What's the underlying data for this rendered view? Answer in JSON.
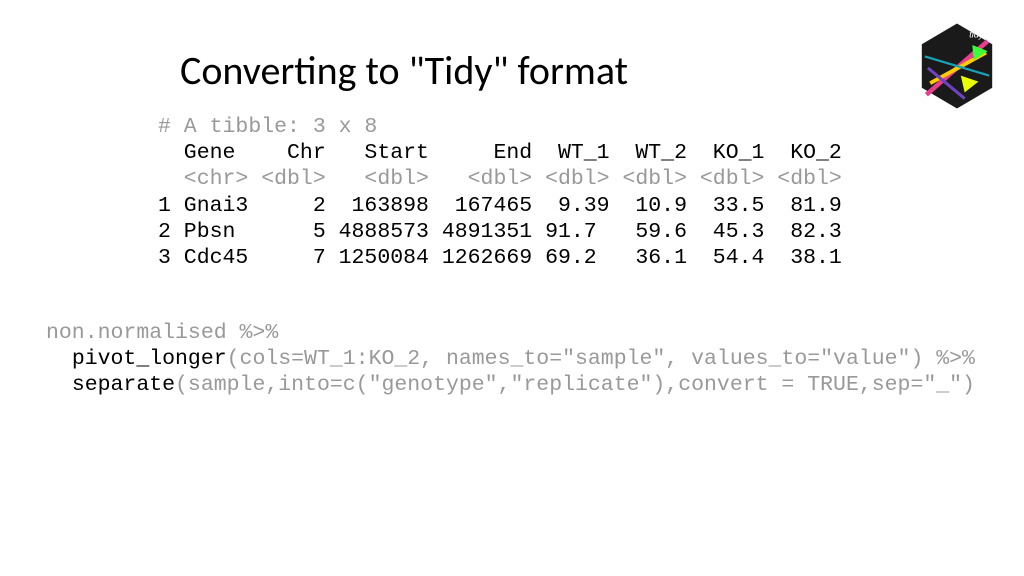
{
  "title": "Converting to \"Tidy\" format",
  "logo": {
    "name": "tidyr-hex-logo"
  },
  "tibble": {
    "header_comment": "# A tibble: 3 x 8",
    "col_header": "  Gene    Chr   Start     End  WT_1  WT_2  KO_1  KO_2",
    "type_row": "  <chr> <dbl>   <dbl>   <dbl> <dbl> <dbl> <dbl> <dbl>",
    "rows": [
      "1 Gnai3     2  163898  167465  9.39  10.9  33.5  81.9",
      "2 Pbsn      5 4888573 4891351 91.7   59.6  45.3  82.3",
      "3 Cdc45     7 1250084 1262669 69.2   36.1  54.4  38.1"
    ]
  },
  "code": {
    "line1_pre": "non.normalised %>%",
    "line2_indent": "  ",
    "line2_fn": "pivot_longer",
    "line2_args": "(cols=WT_1:KO_2, names_to=\"sample\", values_to=\"value\") %>%",
    "line3_indent": "  ",
    "line3_fn": "separate",
    "line3_args": "(sample,into=c(\"genotype\",\"replicate\"),convert = TRUE,sep=\"_\")"
  },
  "chart_data": {
    "type": "table",
    "title": "A tibble: 3 x 8",
    "columns": [
      "Gene",
      "Chr",
      "Start",
      "End",
      "WT_1",
      "WT_2",
      "KO_1",
      "KO_2"
    ],
    "column_types": [
      "<chr>",
      "<dbl>",
      "<dbl>",
      "<dbl>",
      "<dbl>",
      "<dbl>",
      "<dbl>",
      "<dbl>"
    ],
    "rows": [
      {
        "Gene": "Gnai3",
        "Chr": 2,
        "Start": 163898,
        "End": 167465,
        "WT_1": 9.39,
        "WT_2": 10.9,
        "KO_1": 33.5,
        "KO_2": 81.9
      },
      {
        "Gene": "Pbsn",
        "Chr": 5,
        "Start": 4888573,
        "End": 4891351,
        "WT_1": 91.7,
        "WT_2": 59.6,
        "KO_1": 45.3,
        "KO_2": 82.3
      },
      {
        "Gene": "Cdc45",
        "Chr": 7,
        "Start": 1250084,
        "End": 1262669,
        "WT_1": 69.2,
        "WT_2": 36.1,
        "KO_1": 54.4,
        "KO_2": 38.1
      }
    ]
  }
}
